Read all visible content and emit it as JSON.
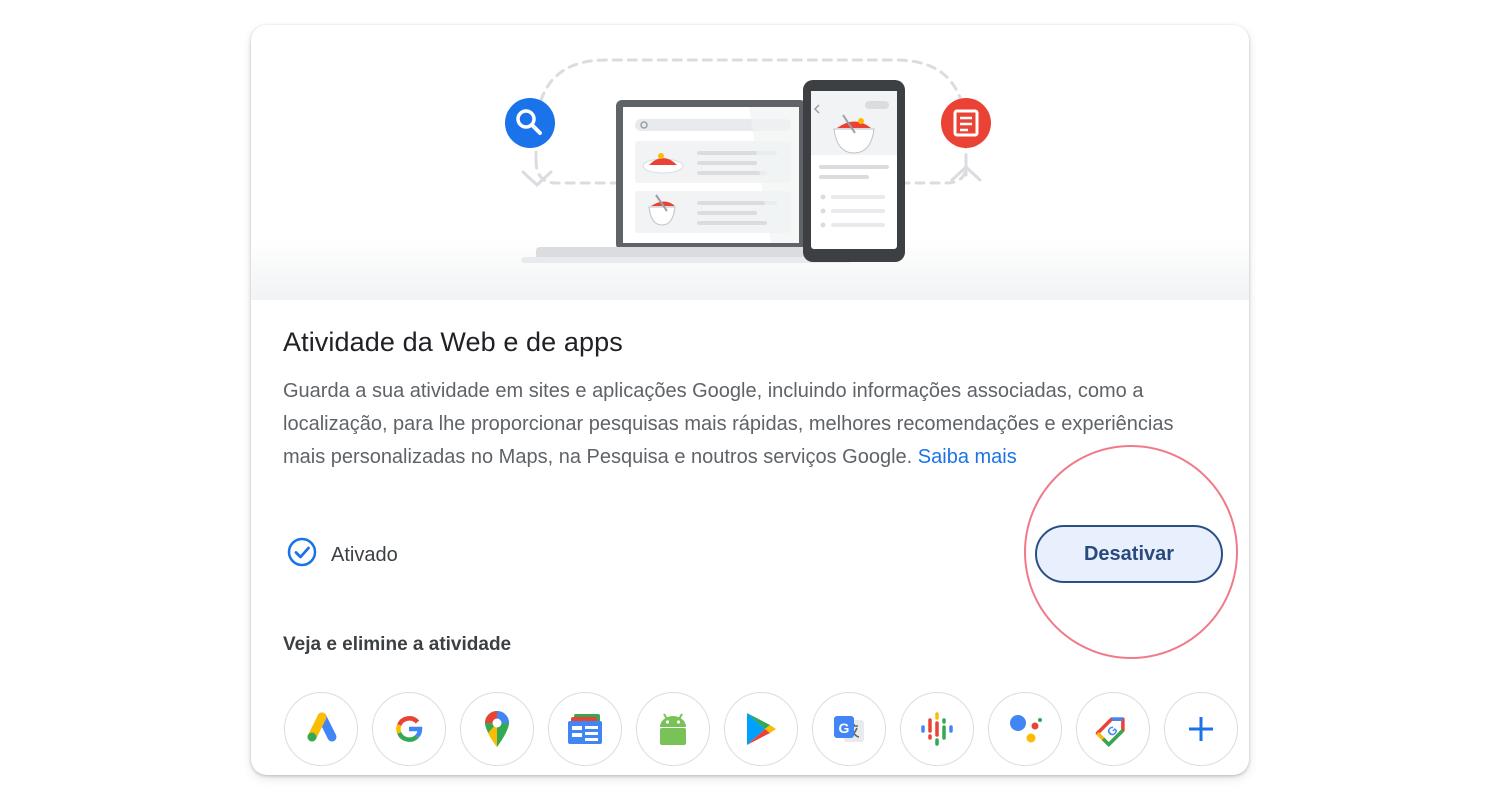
{
  "card": {
    "title": "Atividade da Web e de apps",
    "description": "Guarda a sua atividade em sites e aplicações Google, incluindo informações associadas, como a localização, para lhe proporcionar pesquisas mais rápidas, melhores recomendações e experiências mais personalizadas no Maps, na Pesquisa e noutros serviços Google.",
    "learn_more": "Saiba mais",
    "status": {
      "label": "Ativado",
      "icon": "check-circle-icon"
    },
    "turn_off_button": "Desativar",
    "section_title": "Veja e elimine a atividade",
    "apps": [
      {
        "name": "google-ads",
        "icon": "ads-icon"
      },
      {
        "name": "google-search",
        "icon": "google-g-icon"
      },
      {
        "name": "google-maps",
        "icon": "maps-pin-icon"
      },
      {
        "name": "google-news",
        "icon": "news-icon"
      },
      {
        "name": "android",
        "icon": "android-icon"
      },
      {
        "name": "google-play",
        "icon": "play-icon"
      },
      {
        "name": "google-translate",
        "icon": "translate-icon"
      },
      {
        "name": "google-podcasts",
        "icon": "podcasts-icon"
      },
      {
        "name": "google-assistant",
        "icon": "assistant-icon"
      },
      {
        "name": "google-shopping",
        "icon": "shopping-tag-icon"
      },
      {
        "name": "more",
        "icon": "plus-icon"
      }
    ]
  },
  "colors": {
    "accent_blue": "#1a73e8",
    "button_bg": "#e8f0fe",
    "button_border": "#2a4f86",
    "highlight_ring": "#f07a8a",
    "search_badge": "#1a73e8",
    "doc_badge": "#ea4335"
  }
}
